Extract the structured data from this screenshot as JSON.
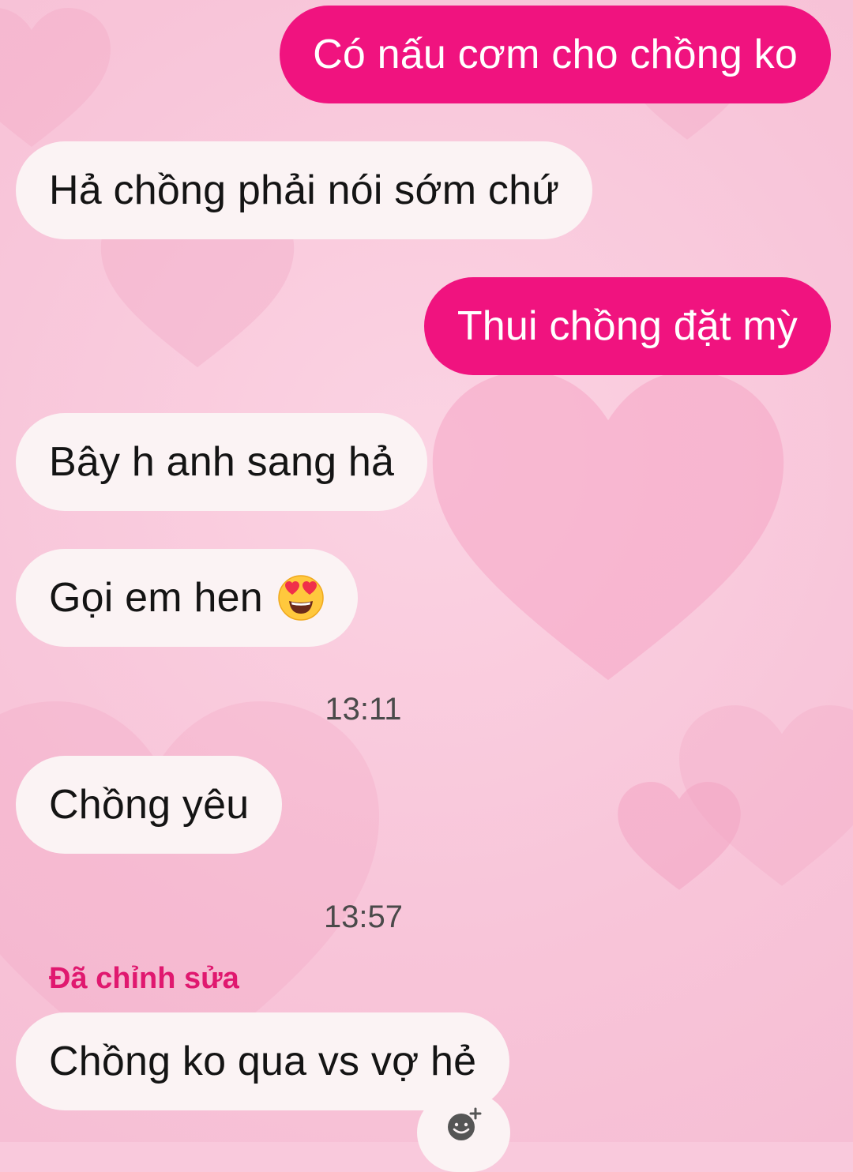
{
  "theme": {
    "outgoing_color": "#f0137f",
    "incoming_color": "#fbf3f4",
    "edited_label_color": "#e0186f"
  },
  "messages": [
    {
      "direction": "outgoing",
      "text": "Có nấu cơm cho chồng ko"
    },
    {
      "direction": "incoming",
      "text": "Hả chồng phải nói sớm chứ"
    },
    {
      "direction": "outgoing",
      "text": "Thui chồng đặt mỳ"
    },
    {
      "direction": "incoming",
      "text": "Bây h anh sang hả"
    },
    {
      "direction": "incoming",
      "text": "Gọi em hen",
      "emoji": "heart-eyes-emoji"
    },
    {
      "direction": "incoming",
      "text": "Chồng yêu"
    },
    {
      "direction": "incoming",
      "text": "Chồng ko qua vs vợ hẻ"
    }
  ],
  "timestamps": [
    "13:11",
    "13:57"
  ],
  "edited_label": "Đã chỉnh sửa",
  "reaction_button_icon": "add-reaction-icon"
}
